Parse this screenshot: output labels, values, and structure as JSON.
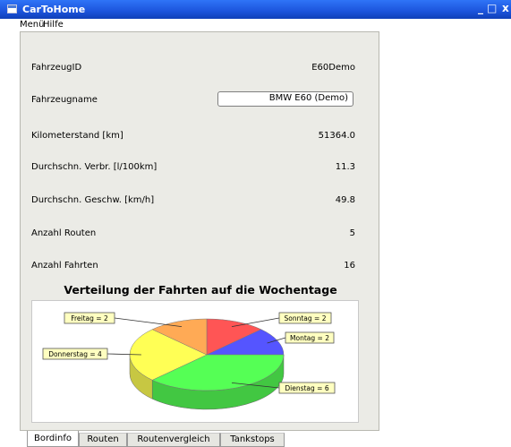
{
  "window": {
    "title": "CarToHome",
    "minimize": "_",
    "maximize": "□",
    "close": "x"
  },
  "menu": {
    "items": [
      "Menü",
      "Hilfe"
    ]
  },
  "fields": [
    {
      "label": "FahrzeugID",
      "value": "E60Demo"
    },
    {
      "label": "Fahrzeugname",
      "value": "BMW E60 (Demo)"
    },
    {
      "label": "Kilometerstand [km]",
      "value": "51364.0"
    },
    {
      "label": "Durchschn. Verbr. [l/100km]",
      "value": "11.3"
    },
    {
      "label": "Durchschn. Geschw. [km/h]",
      "value": "49.8"
    },
    {
      "label": "Anzahl Routen",
      "value": "5"
    },
    {
      "label": "Anzahl Fahrten",
      "value": "16"
    }
  ],
  "tabs": [
    "Bordinfo",
    "Routen",
    "Routenvergleich",
    "Tankstops"
  ],
  "active_tab": "Bordinfo",
  "chart_data": {
    "type": "pie",
    "title": "Verteilung der Fahrten auf die Wochentage",
    "slices": [
      {
        "label": "Sonntag = 2",
        "name": "Sonntag",
        "value": 2,
        "color": "#ff5555"
      },
      {
        "label": "Montag = 2",
        "name": "Montag",
        "value": 2,
        "color": "#5555ff"
      },
      {
        "label": "Dienstag = 6",
        "name": "Dienstag",
        "value": 6,
        "color": "#55ff55"
      },
      {
        "label": "Donnerstag = 4",
        "name": "Donnerstag",
        "value": 4,
        "color": "#ffff55"
      },
      {
        "label": "Freitag = 2",
        "name": "Freitag",
        "value": 2,
        "color": "#ffaa55"
      }
    ],
    "start_angle": "12 o'clock, clockwise",
    "style": "3d"
  }
}
